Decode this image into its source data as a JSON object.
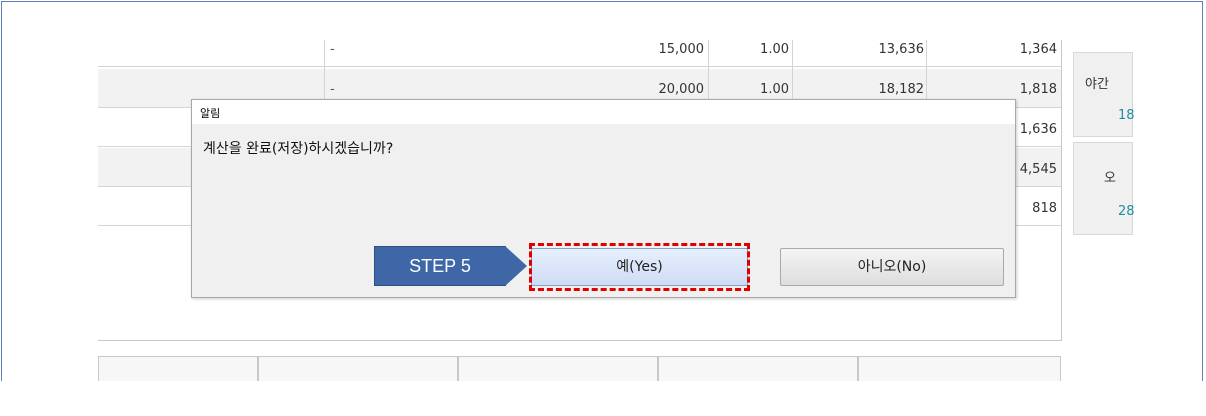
{
  "background_table": {
    "rows": [
      {
        "dash": "-",
        "c1": "15,000",
        "c2": "1.00",
        "c3": "13,636",
        "c4": "1,364"
      },
      {
        "dash": "-",
        "c1": "20,000",
        "c2": "1.00",
        "c3": "18,182",
        "c4": "1,818"
      },
      {
        "dash": "",
        "c1": "",
        "c2": "",
        "c3": "",
        "c4": "1,636"
      },
      {
        "dash": "",
        "c1": "",
        "c2": "",
        "c3": "",
        "c4": "4,545"
      },
      {
        "dash": "",
        "c1": "",
        "c2": "",
        "c3": "",
        "c4": "818"
      }
    ]
  },
  "side": {
    "panel1_label": "야간",
    "panel1_value": "18",
    "panel2_label": "오",
    "panel2_value": "28"
  },
  "bottom_tabs": [
    "",
    "",
    "",
    "",
    ""
  ],
  "dialog": {
    "title": "알림",
    "message": "계산을 완료(저장)하시겠습니까?",
    "yes_label": "예(Yes)",
    "no_label": "아니오(No)"
  },
  "annotation": {
    "step_label": "STEP 5",
    "accent_color": "#3f67a8",
    "highlight_color": "#e00000"
  }
}
